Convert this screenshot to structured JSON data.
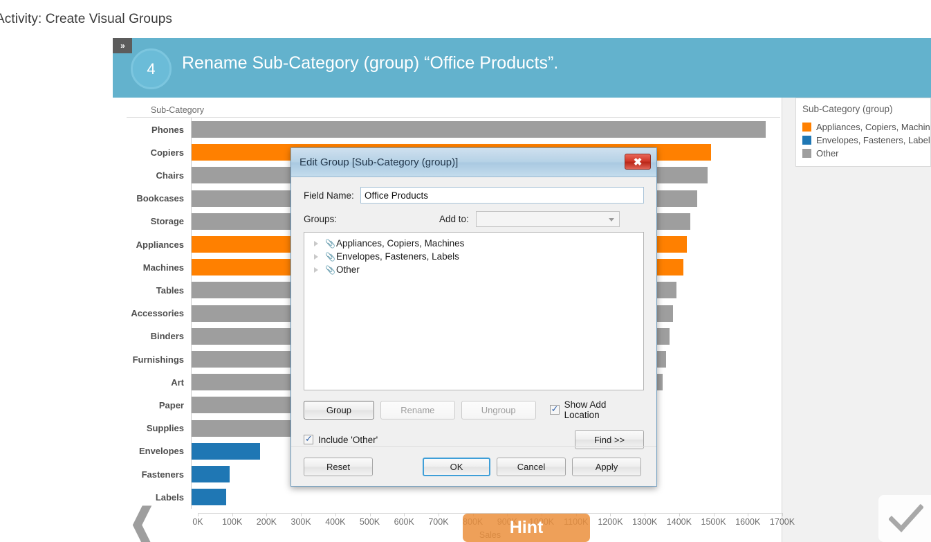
{
  "page": {
    "title": "Activity: Create Visual Groups"
  },
  "banner": {
    "tab_icon": "double-chevron-right-icon",
    "tab_label": "»",
    "step_number": "4",
    "instruction": "Rename Sub-Category (group) “Office Products”.",
    "color": "#63b2cd"
  },
  "chart_data": {
    "type": "bar",
    "orientation": "horizontal",
    "title": "",
    "xlabel": "Sales",
    "ylabel": "Sub-Category",
    "xlim": [
      0,
      1700000
    ],
    "grid": false,
    "legend_position": "right",
    "tick_labels": [
      "0K",
      "100K",
      "200K",
      "300K",
      "400K",
      "500K",
      "600K",
      "700K",
      "800K",
      "900K",
      "1000K",
      "1100K",
      "1200K",
      "1300K",
      "1400K",
      "1500K",
      "1600K",
      "1700K"
    ],
    "tick_values": [
      0,
      100000,
      200000,
      300000,
      400000,
      500000,
      600000,
      700000,
      800000,
      900000,
      1000000,
      1100000,
      1200000,
      1300000,
      1400000,
      1500000,
      1600000,
      1700000
    ],
    "categories": [
      "Phones",
      "Copiers",
      "Chairs",
      "Bookcases",
      "Storage",
      "Appliances",
      "Machines",
      "Tables",
      "Accessories",
      "Binders",
      "Furnishings",
      "Art",
      "Paper",
      "Supplies",
      "Envelopes",
      "Fasteners",
      "Labels"
    ],
    "values": [
      1670000,
      1510000,
      1500000,
      1470000,
      1450000,
      1440000,
      1430000,
      1410000,
      1400000,
      1390000,
      1380000,
      1370000,
      870000,
      860000,
      200000,
      110000,
      100000
    ],
    "colors": [
      "#9e9e9e",
      "#ff8000",
      "#9e9e9e",
      "#9e9e9e",
      "#9e9e9e",
      "#ff8000",
      "#ff8000",
      "#9e9e9e",
      "#9e9e9e",
      "#9e9e9e",
      "#9e9e9e",
      "#9e9e9e",
      "#9e9e9e",
      "#9e9e9e",
      "#1f77b4",
      "#1f77b4",
      "#1f77b4"
    ]
  },
  "legend": {
    "title": "Sub-Category (group)",
    "items": [
      {
        "label": "Appliances, Copiers, Machines",
        "color": "#ff8000"
      },
      {
        "label": "Envelopes, Fasteners, Labels",
        "color": "#1f77b4"
      },
      {
        "label": "Other",
        "color": "#9e9e9e"
      }
    ]
  },
  "dialog": {
    "title": "Edit Group [Sub-Category (group)]",
    "close_label": "✖",
    "field_name_label": "Field Name:",
    "field_name_value": "Office Products",
    "field_name_placeholder": "",
    "groups_label": "Groups:",
    "add_to_label": "Add to:",
    "add_to_value": "",
    "groups": [
      {
        "label": "Appliances, Copiers, Machines",
        "icon": "paperclip-icon"
      },
      {
        "label": "Envelopes, Fasteners, Labels",
        "icon": "paperclip-icon"
      },
      {
        "label": "Other",
        "icon": "paperclip-icon"
      }
    ],
    "group_button": "Group",
    "rename_button": "Rename",
    "ungroup_button": "Ungroup",
    "show_add_location_label": "Show Add Location",
    "include_other_label": "Include 'Other'",
    "find_button": "Find >>",
    "reset_button": "Reset",
    "ok_button": "OK",
    "cancel_button": "Cancel",
    "apply_button": "Apply"
  },
  "overlays": {
    "hint_label": "Hint",
    "hint_color": "#eb8f3c",
    "prev_icon": "chevron-left-icon",
    "done_icon": "checkmark-icon"
  }
}
